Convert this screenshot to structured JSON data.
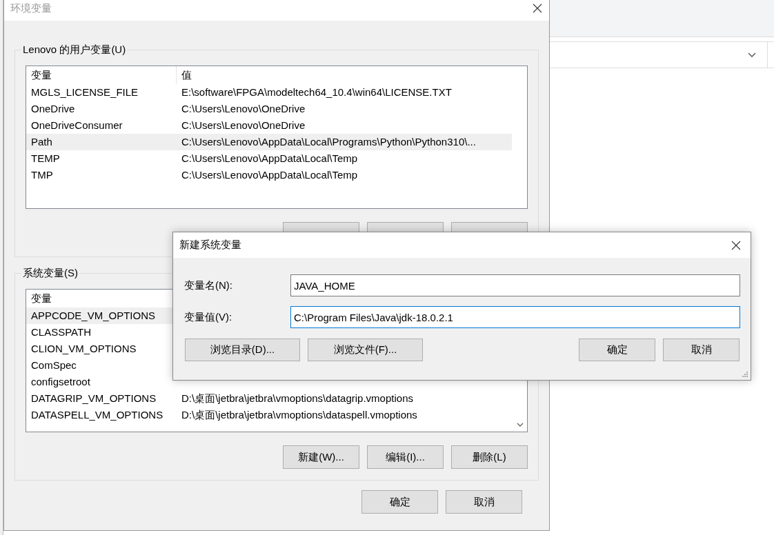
{
  "window": {
    "title": "环境变量",
    "active": false
  },
  "user_variables": {
    "title": "Lenovo 的用户变量(U)",
    "columns": [
      "变量",
      "值"
    ],
    "rows": [
      {
        "name": "MGLS_LICENSE_FILE",
        "value": "E:\\software\\FPGA\\modeltech64_10.4\\win64\\LICENSE.TXT",
        "selected": false
      },
      {
        "name": "OneDrive",
        "value": "C:\\Users\\Lenovo\\OneDrive",
        "selected": false
      },
      {
        "name": "OneDriveConsumer",
        "value": "C:\\Users\\Lenovo\\OneDrive",
        "selected": false
      },
      {
        "name": "Path",
        "value": "C:\\Users\\Lenovo\\AppData\\Local\\Programs\\Python\\Python310\\...",
        "selected": true
      },
      {
        "name": "TEMP",
        "value": "C:\\Users\\Lenovo\\AppData\\Local\\Temp",
        "selected": false
      },
      {
        "name": "TMP",
        "value": "C:\\Users\\Lenovo\\AppData\\Local\\Temp",
        "selected": false
      }
    ],
    "buttons": [
      {
        "covered": true
      },
      {
        "covered": true
      },
      {
        "covered": true
      }
    ]
  },
  "system_variables": {
    "title": "系统变量(S)",
    "columns": [
      "变量"
    ],
    "rows": [
      {
        "name": "APPCODE_VM_OPTIONS",
        "selected": true
      },
      {
        "name": "CLASSPATH",
        "selected": false
      },
      {
        "name": "CLION_VM_OPTIONS",
        "selected": false
      },
      {
        "name": "ComSpec",
        "selected": false
      },
      {
        "name": "configsetroot",
        "selected": false
      },
      {
        "name": "DATAGRIP_VM_OPTIONS",
        "value": "D:\\桌面\\jetbra\\jetbra\\vmoptions\\datagrip.vmoptions",
        "selected": false
      },
      {
        "name": "DATASPELL_VM_OPTIONS",
        "value": "D:\\桌面\\jetbra\\jetbra\\vmoptions\\dataspell.vmoptions",
        "selected": false
      }
    ],
    "buttons": [
      {
        "label": "新建(W)..."
      },
      {
        "label": "编辑(I)..."
      },
      {
        "label": "删除(L)"
      }
    ]
  },
  "footer_buttons": [
    "确定",
    "取消"
  ],
  "dialog": {
    "title": "新建系统变量",
    "fields": [
      {
        "label": "变量名(N):",
        "value": "JAVA_HOME",
        "focused": false
      },
      {
        "label": "变量值(V):",
        "value": "C:\\Program Files\\Java\\jdk-18.0.2.1",
        "focused": true
      }
    ],
    "left_buttons": [
      "浏览目录(D)...",
      "浏览文件(F)..."
    ],
    "right_buttons": [
      "确定",
      "取消"
    ]
  }
}
